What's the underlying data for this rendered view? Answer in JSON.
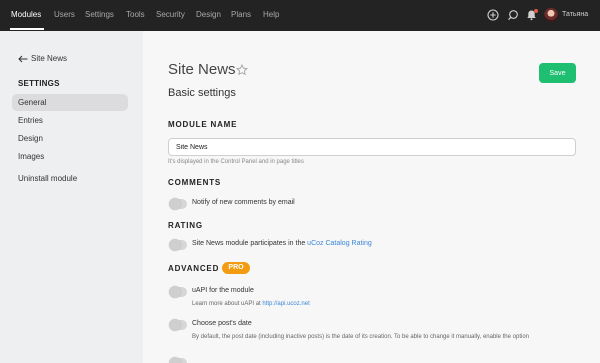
{
  "topnav": {
    "items": [
      {
        "label": "Modules",
        "active": true
      },
      {
        "label": "Users"
      },
      {
        "label": "Settings"
      },
      {
        "label": "Tools"
      },
      {
        "label": "Security"
      },
      {
        "label": "Design"
      },
      {
        "label": "Plans"
      },
      {
        "label": "Help"
      }
    ],
    "user_name": "Татьяна",
    "icons": [
      "add-circle-icon",
      "search-icon",
      "bell-icon",
      "avatar"
    ]
  },
  "sidebar": {
    "back_label": "Site News",
    "heading": "SETTINGS",
    "items": [
      {
        "label": "General",
        "active": true
      },
      {
        "label": "Entries"
      },
      {
        "label": "Design"
      },
      {
        "label": "Images"
      },
      {
        "label": "Uninstall module"
      }
    ]
  },
  "main": {
    "title": "Site News",
    "subtitle": "Basic settings",
    "save_label": "Save",
    "module_name": {
      "heading": "MODULE NAME",
      "value": "Site News",
      "hint": "It's displayed in the Control Panel and in page titles"
    },
    "comments": {
      "heading": "COMMENTS",
      "toggle_label": "Notify of new comments by email"
    },
    "rating": {
      "heading": "RATING",
      "toggle_label_prefix": "Site News module participates in the ",
      "toggle_link": "uCoz Catalog Rating"
    },
    "advanced": {
      "heading": "ADVANCED",
      "badge": "PRO",
      "uapi_label": "uAPI for the module",
      "uapi_note_prefix": "Learn more about uAPI at ",
      "uapi_link": "http://api.ucoz.net",
      "date_label": "Choose post's date",
      "date_note": "By default, the post date (including inactive posts) is the date of its creation. To be able to change it manually, enable the option"
    }
  },
  "colors": {
    "topbar": "#232323",
    "accent": "#1fbf72",
    "pro": "#f39c12",
    "link": "#3c86d6"
  }
}
